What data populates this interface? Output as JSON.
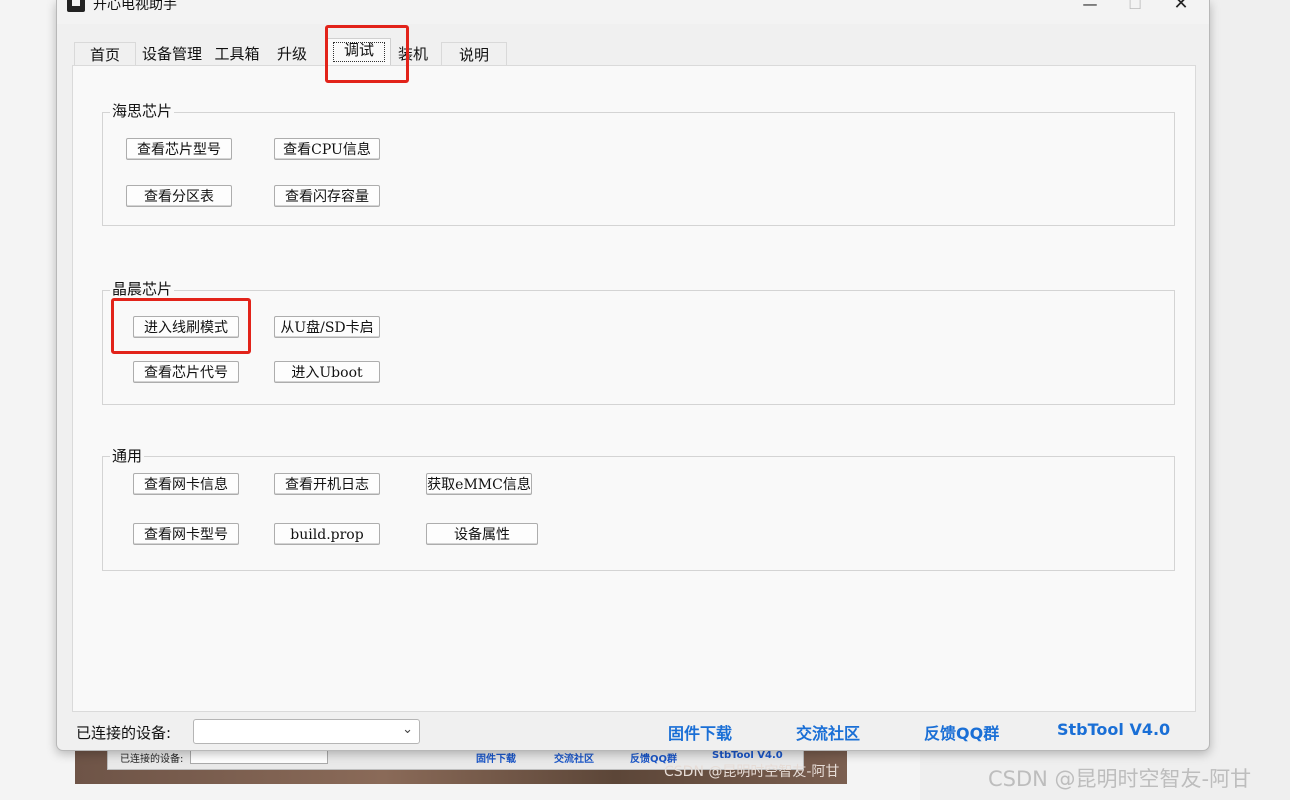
{
  "window": {
    "title": "开心电视助手",
    "controls": {
      "minimize": "—",
      "maximize": "☐",
      "close": "✕"
    }
  },
  "tabs": [
    {
      "label": "首页"
    },
    {
      "label": "设备管理"
    },
    {
      "label": "工具箱"
    },
    {
      "label": "升级"
    },
    {
      "label": "调试",
      "selected": true
    },
    {
      "label": "装机"
    },
    {
      "label": "说明"
    }
  ],
  "groups": {
    "hisilicon": {
      "label": "海思芯片",
      "buttons": [
        "查看芯片型号",
        "查看CPU信息",
        "查看分区表",
        "查看闪存容量"
      ]
    },
    "amlogic": {
      "label": "晶晨芯片",
      "buttons": [
        "进入线刷模式",
        "从U盘/SD卡启",
        "查看芯片代号",
        "进入Uboot"
      ]
    },
    "general": {
      "label": "通用",
      "buttons": [
        "查看网卡信息",
        "查看开机日志",
        "获取eMMC信息",
        "查看网卡型号",
        "build.prop",
        "设备属性"
      ]
    }
  },
  "bottom_bar": {
    "connected_label": "已连接的设备:",
    "device_value": "",
    "links": [
      "固件下载",
      "交流社区",
      "反馈QQ群",
      "StbTool V4.0"
    ]
  },
  "background": {
    "ghost_label": "已连接的设备:",
    "ghost_links": [
      "固件下载",
      "交流社区",
      "反馈QQ群",
      "StbTool V4.0"
    ],
    "watermark_small": "CSDN @昆明时空智友-阿甘",
    "watermark": "CSDN @昆明时空智友-阿甘"
  },
  "colors": {
    "highlight_box": "#e2231a",
    "link": "#1a6fd6"
  }
}
